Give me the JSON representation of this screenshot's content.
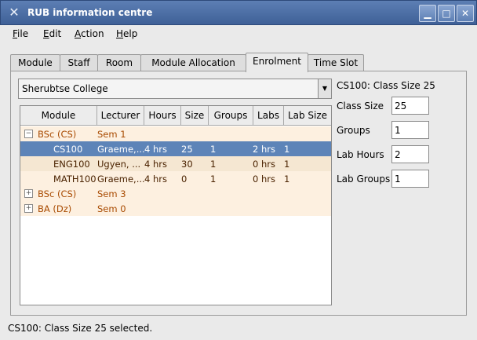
{
  "window": {
    "title": "RUB information centre"
  },
  "menu": [
    {
      "label": "File",
      "u": "F",
      "rest": "ile"
    },
    {
      "label": "Edit",
      "u": "E",
      "rest": "dit"
    },
    {
      "label": "Action",
      "u": "A",
      "rest": "ction"
    },
    {
      "label": "Help",
      "u": "H",
      "rest": "elp"
    }
  ],
  "tabs": [
    "Module",
    "Staff",
    "Room",
    "Module Allocation",
    "Enrolment",
    "Time Slot"
  ],
  "active_tab": "Enrolment",
  "college_select": {
    "value": "Sherubtse College"
  },
  "table": {
    "columns": [
      "Module",
      "Lecturer",
      "Hours",
      "Size",
      "Groups",
      "Labs",
      "Lab Size"
    ],
    "rows": [
      {
        "type": "group",
        "expander": "−",
        "cells": [
          "BSc (CS)",
          "Sem 1",
          "",
          "",
          "",
          "",
          ""
        ]
      },
      {
        "type": "selected",
        "cells": [
          "CS100",
          "Graeme,...",
          "4 hrs",
          "25",
          "1",
          "2 hrs",
          "1"
        ]
      },
      {
        "type": "child",
        "cells": [
          "ENG100",
          "Ugyen, ...",
          "4 hrs",
          "30",
          "1",
          "0 hrs",
          "1"
        ]
      },
      {
        "type": "child2",
        "cells": [
          "MATH100",
          "Graeme,...",
          "4 hrs",
          "0",
          "1",
          "0 hrs",
          "1"
        ]
      },
      {
        "type": "group",
        "expander": "+",
        "cells": [
          "BSc (CS)",
          "Sem 3",
          "",
          "",
          "",
          "",
          ""
        ]
      },
      {
        "type": "group",
        "expander": "+",
        "cells": [
          "BA (Dz)",
          "Sem 0",
          "",
          "",
          "",
          "",
          ""
        ]
      }
    ]
  },
  "details": {
    "heading": "CS100: Class Size 25",
    "fields": [
      {
        "label": "Class Size",
        "value": "25"
      },
      {
        "label": "Groups",
        "value": "1"
      },
      {
        "label": "Lab Hours",
        "value": "2"
      },
      {
        "label": "Lab Groups",
        "value": "1"
      }
    ]
  },
  "status": "CS100: Class Size 25 selected."
}
